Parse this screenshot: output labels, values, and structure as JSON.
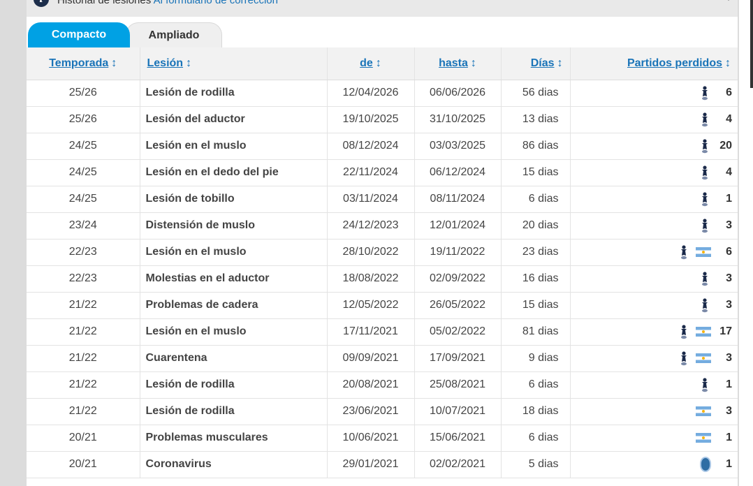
{
  "header": {
    "title": "Historial de lesiones",
    "link": "Al formulario de corrección"
  },
  "tabs": [
    {
      "label": "Compacto",
      "active": true
    },
    {
      "label": "Ampliado",
      "active": false
    }
  ],
  "table": {
    "headers": {
      "season": "Temporada",
      "injury": "Lesión",
      "from": "de",
      "until": "hasta",
      "days": "Días",
      "missed": "Partidos perdidos"
    },
    "sort_glyph": "↕",
    "rows": [
      {
        "season": "25/26",
        "injury": "Lesión de rodilla",
        "from": "12/04/2026",
        "until": "06/06/2026",
        "days": "56 dias",
        "games": "6",
        "icons": [
          "club-icon"
        ]
      },
      {
        "season": "25/26",
        "injury": "Lesión del aductor",
        "from": "19/10/2025",
        "until": "31/10/2025",
        "days": "13 dias",
        "games": "4",
        "icons": [
          "club-icon"
        ]
      },
      {
        "season": "24/25",
        "injury": "Lesión en el muslo",
        "from": "08/12/2024",
        "until": "03/03/2025",
        "days": "86 dias",
        "games": "20",
        "icons": [
          "club-icon"
        ]
      },
      {
        "season": "24/25",
        "injury": "Lesión en el dedo del pie",
        "from": "22/11/2024",
        "until": "06/12/2024",
        "days": "15 dias",
        "games": "4",
        "icons": [
          "club-icon"
        ]
      },
      {
        "season": "24/25",
        "injury": "Lesión de tobillo",
        "from": "03/11/2024",
        "until": "08/11/2024",
        "days": "6 dias",
        "games": "1",
        "icons": [
          "club-icon"
        ]
      },
      {
        "season": "23/24",
        "injury": "Distensión de muslo",
        "from": "24/12/2023",
        "until": "12/01/2024",
        "days": "20 dias",
        "games": "3",
        "icons": [
          "club-icon"
        ]
      },
      {
        "season": "22/23",
        "injury": "Lesión en el muslo",
        "from": "28/10/2022",
        "until": "19/11/2022",
        "days": "23 dias",
        "games": "6",
        "icons": [
          "club-icon",
          "flag-icon"
        ]
      },
      {
        "season": "22/23",
        "injury": "Molestias en el aductor",
        "from": "18/08/2022",
        "until": "02/09/2022",
        "days": "16 dias",
        "games": "3",
        "icons": [
          "club-icon"
        ]
      },
      {
        "season": "21/22",
        "injury": "Problemas de cadera",
        "from": "12/05/2022",
        "until": "26/05/2022",
        "days": "15 dias",
        "games": "3",
        "icons": [
          "club-icon"
        ]
      },
      {
        "season": "21/22",
        "injury": "Lesión en el muslo",
        "from": "17/11/2021",
        "until": "05/02/2022",
        "days": "81 dias",
        "games": "17",
        "icons": [
          "club-icon",
          "flag-icon"
        ]
      },
      {
        "season": "21/22",
        "injury": "Cuarentena",
        "from": "09/09/2021",
        "until": "17/09/2021",
        "days": "9 dias",
        "games": "3",
        "icons": [
          "club-icon",
          "flag-icon"
        ]
      },
      {
        "season": "21/22",
        "injury": "Lesión de rodilla",
        "from": "20/08/2021",
        "until": "25/08/2021",
        "days": "6 dias",
        "games": "1",
        "icons": [
          "club-icon"
        ]
      },
      {
        "season": "21/22",
        "injury": "Lesión de rodilla",
        "from": "23/06/2021",
        "until": "10/07/2021",
        "days": "18 dias",
        "games": "3",
        "icons": [
          "flag-icon"
        ]
      },
      {
        "season": "20/21",
        "injury": "Problemas musculares",
        "from": "10/06/2021",
        "until": "15/06/2021",
        "days": "6 dias",
        "games": "1",
        "icons": [
          "flag-icon"
        ]
      },
      {
        "season": "20/21",
        "injury": "Coronavirus",
        "from": "29/01/2021",
        "until": "02/02/2021",
        "days": "5 dias",
        "games": "1",
        "icons": [
          "badge-icon"
        ]
      }
    ]
  },
  "colors": {
    "accent": "#00a1e4",
    "link": "#1a74b8",
    "header_bg": "#f2f2f2"
  }
}
